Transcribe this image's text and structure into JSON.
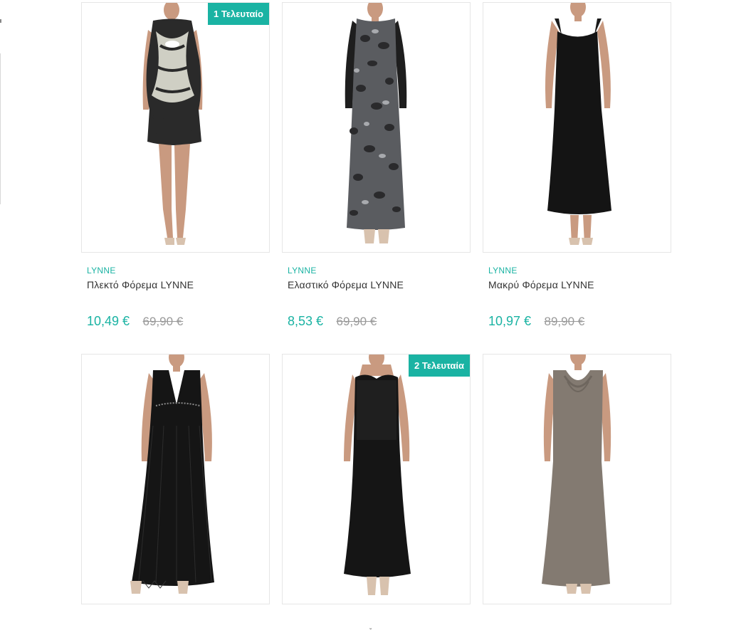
{
  "products": [
    {
      "brand": "LYNNE",
      "title": "Πλεκτό Φόρεμα LYNNE",
      "price": "10,49 €",
      "old_price": "69,90 €",
      "badge": "1 Τελευταίο",
      "image_alt": "patterned bodycon dress"
    },
    {
      "brand": "LYNNE",
      "title": "Ελαστικό Φόρεμα LYNNE",
      "price": "8,53 €",
      "old_price": "69,90 €",
      "badge": "",
      "image_alt": "leopard print maxi dress"
    },
    {
      "brand": "LYNNE",
      "title": "Μακρύ Φόρεμα LYNNE",
      "price": "10,97 €",
      "old_price": "89,90 €",
      "badge": "",
      "image_alt": "black maxi dress"
    },
    {
      "brand": "",
      "title": "",
      "price": "",
      "old_price": "",
      "badge": "",
      "image_alt": "black v-neck pleated maxi dress"
    },
    {
      "brand": "",
      "title": "",
      "price": "",
      "old_price": "",
      "badge": "2 Τελευταία",
      "image_alt": "black strapless maxi dress"
    },
    {
      "brand": "",
      "title": "",
      "price": "",
      "old_price": "",
      "badge": "",
      "image_alt": "taupe cowl neck maxi dress"
    }
  ],
  "colors": {
    "accent": "#1ab3a3",
    "title_text": "#333333",
    "old_price": "#999999",
    "card_border": "#e6e6e6"
  },
  "scroll_indicator": "ˇ"
}
